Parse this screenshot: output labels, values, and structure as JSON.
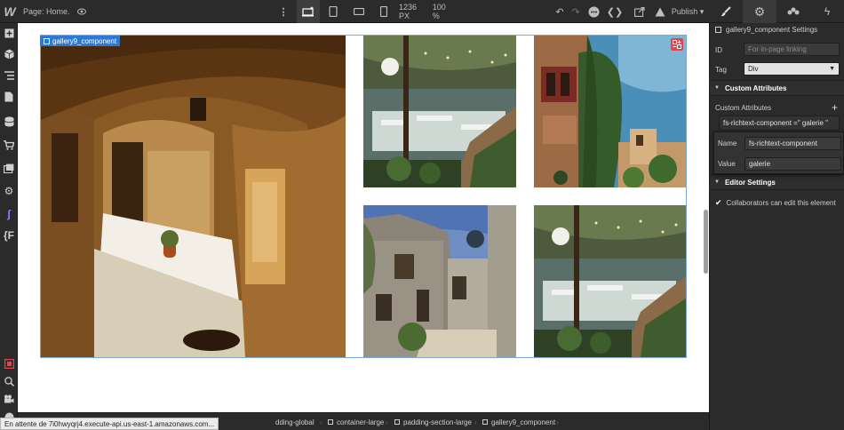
{
  "topbar": {
    "logo": "W",
    "page_label": "Page: Home.",
    "breakpoint_width": "1236 PX",
    "zoom": "100 %",
    "publish_label": "Publish",
    "icons": {
      "preview": "eye-icon",
      "more": "more-vertical-icon",
      "desktop": "desktop-star-icon",
      "tablet": "tablet-icon",
      "landscape": "mobile-landscape-icon",
      "portrait": "mobile-portrait-icon",
      "undo": "undo-icon",
      "redo": "redo-icon",
      "comment": "comment-icon",
      "code": "code-icon",
      "export": "export-icon",
      "help": "help-icon"
    }
  },
  "leftbar": {
    "items": [
      "add-icon",
      "cube-icon",
      "navigator-icon",
      "pages-icon",
      "cms-icon",
      "ecommerce-icon",
      "assets-icon",
      "settings-icon",
      "finsweet-icon",
      "variables-icon"
    ],
    "bottom": [
      "record-icon",
      "search-icon",
      "video-icon",
      "help-icon"
    ]
  },
  "canvas": {
    "selected_label": "gallery9_component",
    "images": [
      {
        "name": "gallery-image-stone-passage"
      },
      {
        "name": "gallery-image-terrace-cafe"
      },
      {
        "name": "gallery-image-ivy-house"
      },
      {
        "name": "gallery-image-village-street"
      },
      {
        "name": "gallery-image-terrace-cafe-2"
      }
    ]
  },
  "breadcrumb": {
    "items": [
      "dding-global",
      "container-large",
      "padding-section-large",
      "gallery9_component"
    ]
  },
  "status_text": "En attente de 7i0hwyqrj4.execute-api.us-east-1.amazonaws.com...",
  "panel": {
    "tabs": [
      "style-brush-icon",
      "settings-gear-icon",
      "interactions-icon",
      "lightning-icon"
    ],
    "settings_title": "gallery9_component Settings",
    "id_label": "ID",
    "id_placeholder": "For in-page linking",
    "tag_label": "Tag",
    "tag_value": "Div",
    "custom_attr_header": "Custom Attributes",
    "custom_attr_label": "Custom Attributes",
    "custom_attr_item": "fs-richtext-component =\" galerie \"",
    "name_label": "Name",
    "name_value": "fs-richtext-component",
    "value_label": "Value",
    "value_value": "galerie",
    "editor_settings_header": "Editor Settings",
    "collab_label": "Collaborators can edit this element"
  },
  "colors": {
    "accent": "#2d7ad6",
    "ui_bg": "#2b2b2b",
    "badge": "#e0464b"
  }
}
